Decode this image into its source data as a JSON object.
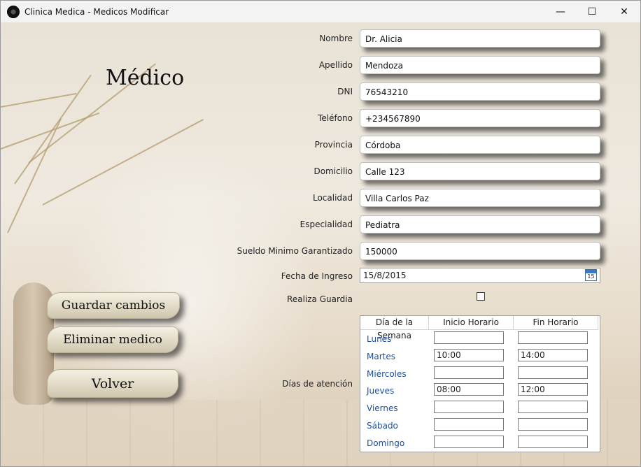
{
  "window": {
    "title": "Clinica Medica - Medicos Modificar",
    "minimize_glyph": "—",
    "maximize_glyph": "☐",
    "close_glyph": "✕"
  },
  "heading": "Médico",
  "fields": {
    "nombre": {
      "label": "Nombre",
      "value": "Dr. Alicia"
    },
    "apellido": {
      "label": "Apellido",
      "value": "Mendoza"
    },
    "dni": {
      "label": "DNI",
      "value": "76543210"
    },
    "telefono": {
      "label": "Teléfono",
      "value": "+234567890"
    },
    "provincia": {
      "label": "Provincia",
      "value": "Córdoba"
    },
    "domicilio": {
      "label": "Domicilio",
      "value": "Calle 123"
    },
    "localidad": {
      "label": "Localidad",
      "value": "Villa Carlos Paz"
    },
    "especialidad": {
      "label": "Especialidad",
      "value": "Pediatra"
    },
    "sueldo": {
      "label": "Sueldo Minimo Garantizado",
      "value": "150000"
    }
  },
  "fecha_ingreso": {
    "label": "Fecha de Ingreso",
    "value": "15/8/2015",
    "calendar_day": "15"
  },
  "guardia": {
    "label": "Realiza Guardia",
    "checked": false
  },
  "horario": {
    "label": "Días de atención",
    "columns": [
      "Día de la Semana",
      "Inicio Horario",
      "Fin Horario"
    ],
    "rows": [
      {
        "day": "Lunes",
        "inicio": "",
        "fin": ""
      },
      {
        "day": "Martes",
        "inicio": "10:00",
        "fin": "14:00"
      },
      {
        "day": "Miércoles",
        "inicio": "",
        "fin": ""
      },
      {
        "day": "Jueves",
        "inicio": "08:00",
        "fin": "12:00"
      },
      {
        "day": "Viernes",
        "inicio": "",
        "fin": ""
      },
      {
        "day": "Sábado",
        "inicio": "",
        "fin": ""
      },
      {
        "day": "Domingo",
        "inicio": "",
        "fin": ""
      }
    ]
  },
  "buttons": {
    "guardar": "Guardar cambios",
    "eliminar": "Eliminar medico",
    "volver": "Volver"
  },
  "icons": {
    "app": "app-logo-icon",
    "calendar": "calendar-icon"
  }
}
